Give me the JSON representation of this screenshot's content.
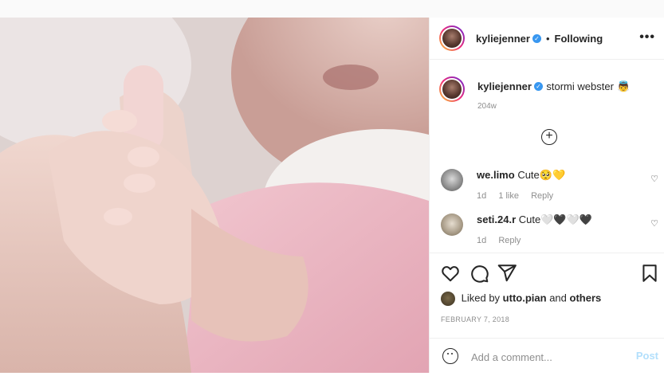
{
  "post": {
    "author": "kyliejenner",
    "follow_status": "Following",
    "separator": "•",
    "more_icon": "more-horizontal-icon",
    "caption": "stormi webster",
    "caption_emoji": "👼",
    "caption_age": "204w",
    "load_more_icon": "plus-circle-icon"
  },
  "comments": [
    {
      "user": "we.limo",
      "text": "Cute🥺💛",
      "age": "1d",
      "likes": "1 like",
      "reply": "Reply"
    },
    {
      "user": "seti.24.r",
      "text": "Cute🤍🖤🤍🖤",
      "age": "1d",
      "likes": "",
      "reply": "Reply"
    }
  ],
  "actions": {
    "like_icon": "heart-icon",
    "comment_icon": "comment-icon",
    "share_icon": "send-icon",
    "save_icon": "bookmark-icon"
  },
  "liked_by": {
    "prefix": "Liked by",
    "user": "utto.pian",
    "connector": "and",
    "suffix": "others"
  },
  "date": "FEBRUARY 7, 2018",
  "add_comment": {
    "placeholder": "Add a comment...",
    "post_label": "Post",
    "emoji_icon": "emoji-icon"
  },
  "colors": {
    "accent_blue": "#3897f0",
    "post_disabled": "#b2dffc",
    "muted": "#8e8e8e"
  }
}
